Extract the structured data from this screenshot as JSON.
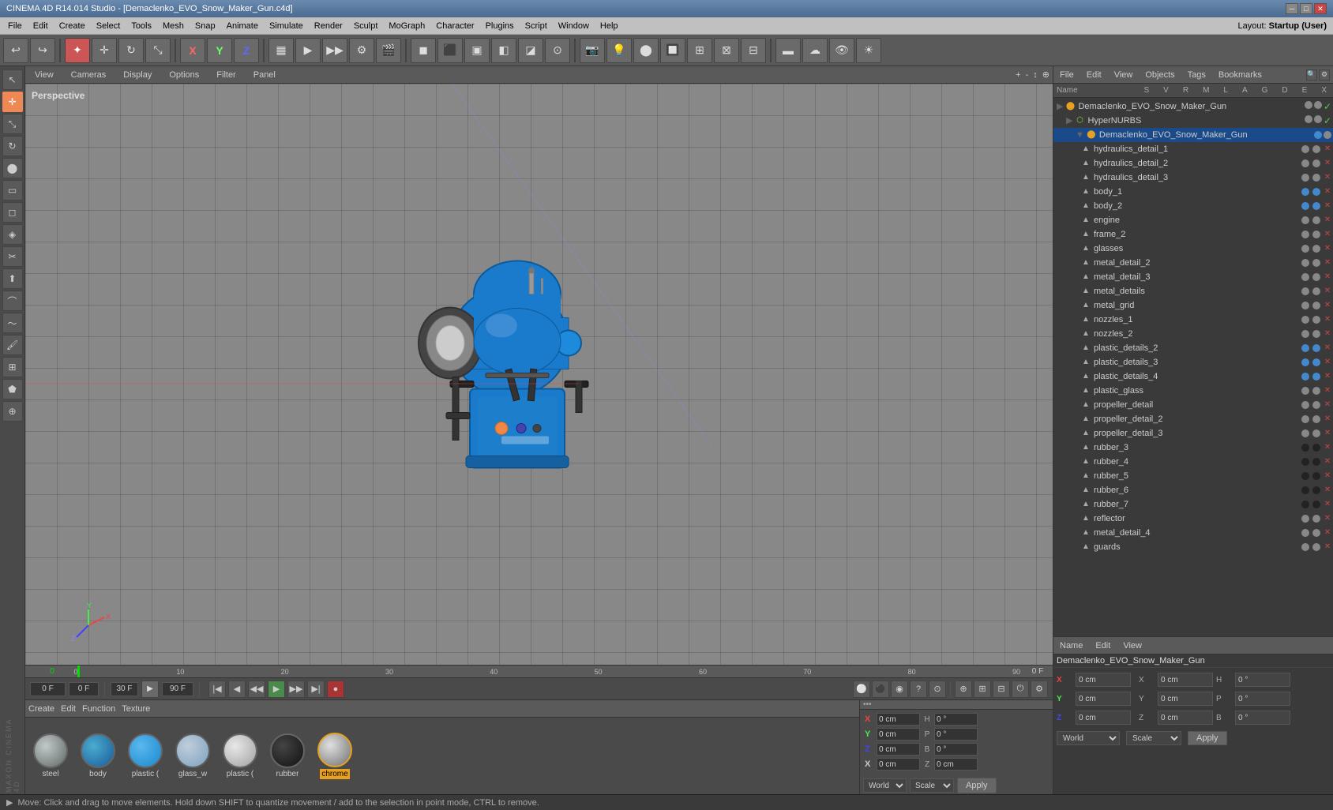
{
  "titleBar": {
    "title": "CINEMA 4D R14.014 Studio - [Demaclenko_EVO_Snow_Maker_Gun.c4d]",
    "controls": [
      "minimize",
      "maximize",
      "close"
    ]
  },
  "menuBar": {
    "items": [
      "File",
      "Edit",
      "Create",
      "Select",
      "Tools",
      "Mesh",
      "Snap",
      "Animate",
      "Simulate",
      "Render",
      "Sculpt",
      "MoGraph",
      "Character",
      "Plugins",
      "Script",
      "Window",
      "Help"
    ],
    "layoutLabel": "Layout:",
    "layoutValue": "Startup (User)"
  },
  "toolbar": {
    "icons": [
      "undo",
      "redo",
      "mode-select",
      "mode-move",
      "mode-rotate",
      "mode-scale",
      "x-axis",
      "y-axis",
      "z-axis",
      "coord-sys",
      "render-region",
      "render-view",
      "render",
      "render-queue",
      "edit-render",
      "obj-mode",
      "points-mode",
      "edges-mode",
      "poly-mode",
      "uvw-mode",
      "solo",
      "camera-add",
      "camera-sel",
      "material-add",
      "snap-on",
      "snap-grid",
      "snap-guide",
      "snap-all",
      "snap-none",
      "floor",
      "sky",
      "stereo"
    ]
  },
  "viewport": {
    "tabs": [
      "View",
      "Cameras",
      "Display",
      "Options",
      "Filter",
      "Panel"
    ],
    "perspectiveLabel": "Perspective",
    "navIcons": [
      "+",
      "-",
      "↕",
      "⊕"
    ]
  },
  "timeline": {
    "start": 0,
    "end": 90,
    "current": 0,
    "fps": 30,
    "ticks": [
      0,
      10,
      20,
      30,
      40,
      50,
      60,
      70,
      80,
      90
    ],
    "frameLabel": "0 F",
    "endFrameLabel": "90 F",
    "inputCurrent": "0 F",
    "inputEnd": "90 F"
  },
  "transport": {
    "buttons": [
      "start",
      "prev",
      "play-back",
      "stop",
      "play",
      "next",
      "end",
      "record"
    ],
    "currentFrame": "0 F",
    "totalFrame": "90 F",
    "playLabel": "►"
  },
  "objectManager": {
    "header": [
      "File",
      "Edit",
      "View",
      "Objects",
      "Tags",
      "Bookmarks"
    ],
    "rootName": "Demaclenko_EVO_Snow_Maker_Gun",
    "items": [
      {
        "name": "Demaclenko_EVO_Snow_Maker_Gun",
        "level": 0,
        "type": "root",
        "hasDots": true,
        "dotColor": "blue"
      },
      {
        "name": "HyperNURBS",
        "level": 1,
        "type": "nurbs",
        "hasDots": true,
        "dotColor": "green"
      },
      {
        "name": "Demaclenko_EVO_Snow_Maker_Gun",
        "level": 2,
        "type": "group",
        "hasDots": true,
        "dotColor": "blue"
      },
      {
        "name": "hydraulics_detail_1",
        "level": 3,
        "type": "obj",
        "hasDots": true
      },
      {
        "name": "hydraulics_detail_2",
        "level": 3,
        "type": "obj",
        "hasDots": true
      },
      {
        "name": "hydraulics_detail_3",
        "level": 3,
        "type": "obj",
        "hasDots": true
      },
      {
        "name": "body_1",
        "level": 3,
        "type": "obj",
        "hasDots": true,
        "dotColor": "blue"
      },
      {
        "name": "body_2",
        "level": 3,
        "type": "obj",
        "hasDots": true,
        "dotColor": "blue"
      },
      {
        "name": "engine",
        "level": 3,
        "type": "obj",
        "hasDots": true
      },
      {
        "name": "frame_2",
        "level": 3,
        "type": "obj",
        "hasDots": true
      },
      {
        "name": "glasses",
        "level": 3,
        "type": "obj",
        "hasDots": true
      },
      {
        "name": "metal_detail_2",
        "level": 3,
        "type": "obj",
        "hasDots": true
      },
      {
        "name": "metal_detail_3",
        "level": 3,
        "type": "obj",
        "hasDots": true
      },
      {
        "name": "metal_details",
        "level": 3,
        "type": "obj",
        "hasDots": true
      },
      {
        "name": "metal_grid",
        "level": 3,
        "type": "obj",
        "hasDots": true
      },
      {
        "name": "nozzles_1",
        "level": 3,
        "type": "obj",
        "hasDots": true
      },
      {
        "name": "nozzles_2",
        "level": 3,
        "type": "obj",
        "hasDots": true
      },
      {
        "name": "plastic_details_2",
        "level": 3,
        "type": "obj",
        "hasDots": true,
        "dotColor": "blue"
      },
      {
        "name": "plastic_details_3",
        "level": 3,
        "type": "obj",
        "hasDots": true,
        "dotColor": "blue"
      },
      {
        "name": "plastic_details_4",
        "level": 3,
        "type": "obj",
        "hasDots": true,
        "dotColor": "blue"
      },
      {
        "name": "plastic_glass",
        "level": 3,
        "type": "obj",
        "hasDots": true
      },
      {
        "name": "propeller_detail",
        "level": 3,
        "type": "obj",
        "hasDots": true
      },
      {
        "name": "propeller_detail_2",
        "level": 3,
        "type": "obj",
        "hasDots": true
      },
      {
        "name": "propeller_detail_3",
        "level": 3,
        "type": "obj",
        "hasDots": true
      },
      {
        "name": "rubber_3",
        "level": 3,
        "type": "obj",
        "hasDots": true,
        "dotColor": "black"
      },
      {
        "name": "rubber_4",
        "level": 3,
        "type": "obj",
        "hasDots": true,
        "dotColor": "black"
      },
      {
        "name": "rubber_5",
        "level": 3,
        "type": "obj",
        "hasDots": true,
        "dotColor": "black"
      },
      {
        "name": "rubber_6",
        "level": 3,
        "type": "obj",
        "hasDots": true,
        "dotColor": "black"
      },
      {
        "name": "rubber_7",
        "level": 3,
        "type": "obj",
        "hasDots": true,
        "dotColor": "black"
      },
      {
        "name": "reflector",
        "level": 3,
        "type": "obj",
        "hasDots": true
      },
      {
        "name": "metal_detail_4",
        "level": 3,
        "type": "obj",
        "hasDots": true
      },
      {
        "name": "guards",
        "level": 3,
        "type": "obj",
        "hasDots": true
      }
    ]
  },
  "attributeManager": {
    "header": [
      "Name",
      "Edit",
      "View"
    ],
    "selectedName": "Demaclenko_EVO_Snow_Maker_Gun",
    "coords": {
      "x": {
        "pos": "0 cm",
        "size": "0 cm",
        "rot": "0 °"
      },
      "y": {
        "pos": "0 cm",
        "size": "0 cm",
        "rot": "0 °"
      },
      "z": {
        "pos": "0 cm",
        "size": "0 cm",
        "rot": "0 °"
      }
    },
    "coordSystem": "World",
    "transformMode": "Scale",
    "applyLabel": "Apply",
    "hLabel": "H",
    "pLabel": "P",
    "bLabel": "B"
  },
  "materials": {
    "toolbar": [
      "Create",
      "Edit",
      "Function",
      "Texture"
    ],
    "items": [
      {
        "name": "steel",
        "color": "#8a9090",
        "type": "metal"
      },
      {
        "name": "body",
        "color": "#1a6aaa",
        "type": "glossy"
      },
      {
        "name": "plastic (",
        "color": "#2288cc",
        "type": "plastic"
      },
      {
        "name": "glass_w",
        "color": "#aabbcc",
        "type": "glass"
      },
      {
        "name": "plastic (",
        "color": "#cccccc",
        "type": "plastic2"
      },
      {
        "name": "rubber",
        "color": "#222222",
        "type": "rubber"
      },
      {
        "name": "chrome",
        "color": "#aaaaaa",
        "type": "chrome",
        "selected": true
      }
    ]
  },
  "statusBar": {
    "text": "Move: Click and drag to move elements. Hold down SHIFT to quantize movement / add to the selection in point mode, CTRL to remove."
  }
}
